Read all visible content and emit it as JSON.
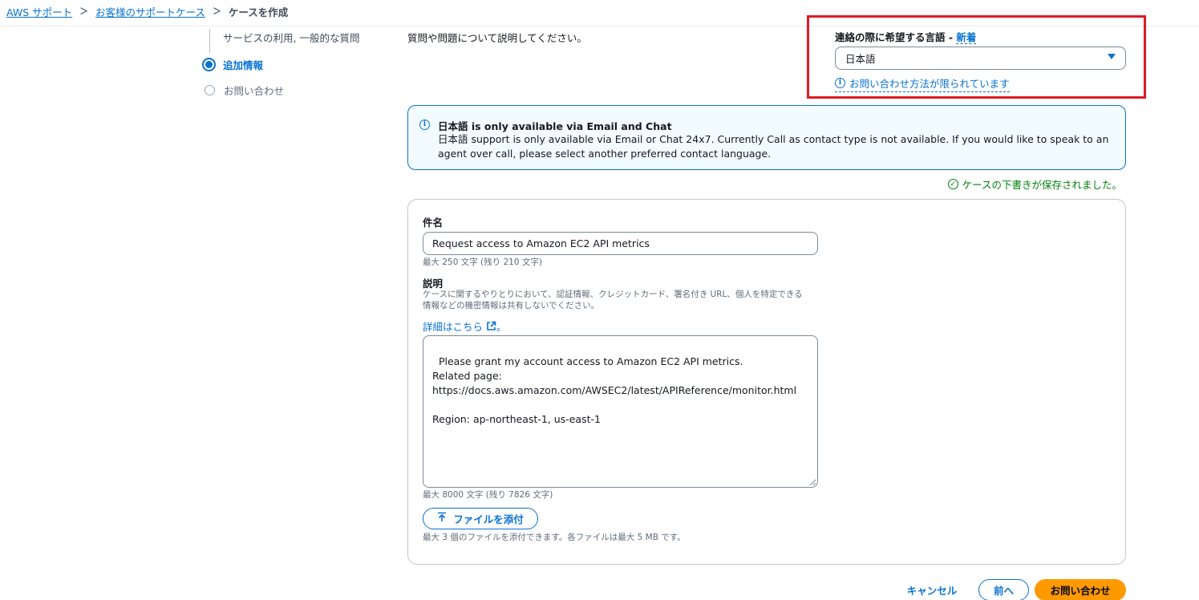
{
  "breadcrumb": {
    "items": [
      "AWS サポート",
      "お客様のサポートケース"
    ],
    "current": "ケースを作成"
  },
  "steps": {
    "previous_partial": "サービスの利用, 一般的な質問",
    "active": "追加情報",
    "next": "お問い合わせ"
  },
  "description_intro": "質問や問題について説明してください。",
  "language": {
    "label": "連絡の際に希望する言語 - ",
    "new_badge": "新着",
    "selected": "日本語",
    "limited_link": "お問い合わせ方法が限られています"
  },
  "alert": {
    "title": "日本語 is only available via Email and Chat",
    "body": "日本語 support is only available via Email or Chat 24x7. Currently Call as contact type is not available. If you would like to speak to an agent over call, please select another preferred contact language."
  },
  "draft_saved": "ケースの下書きが保存されました。",
  "subject": {
    "label": "件名",
    "value": "Request access to Amazon EC2 API metrics",
    "hint": "最大 250 文字 (残り 210 文字)"
  },
  "description": {
    "label": "説明",
    "hint_line1": "ケースに関するやりとりにおいて、認証情報、クレジットカード、署名付き URL、個人を特定できる",
    "hint_line2": "情報などの機密情報は共有しないでください。",
    "learn_more": "詳細はこちら",
    "learn_more_suffix": "。",
    "value": "Please grant my account access to Amazon EC2 API metrics.\nRelated page:\nhttps://docs.aws.amazon.com/AWSEC2/latest/APIReference/monitor.html\n\nRegion: ap-northeast-1, us-east-1",
    "hint": "最大 8000 文字 (残り 7826 文字)"
  },
  "attach": {
    "label": "ファイルを添付",
    "hint": "最大 3 個のファイルを添付できます。各ファイルは最大 5 MB です。"
  },
  "actions": {
    "cancel": "キャンセル",
    "prev": "前へ",
    "submit": "お問い合わせ"
  },
  "colors": {
    "link": "#0972d3",
    "primary_button": "#ff9900",
    "highlight_box": "#e01b24",
    "success": "#037f0c"
  }
}
